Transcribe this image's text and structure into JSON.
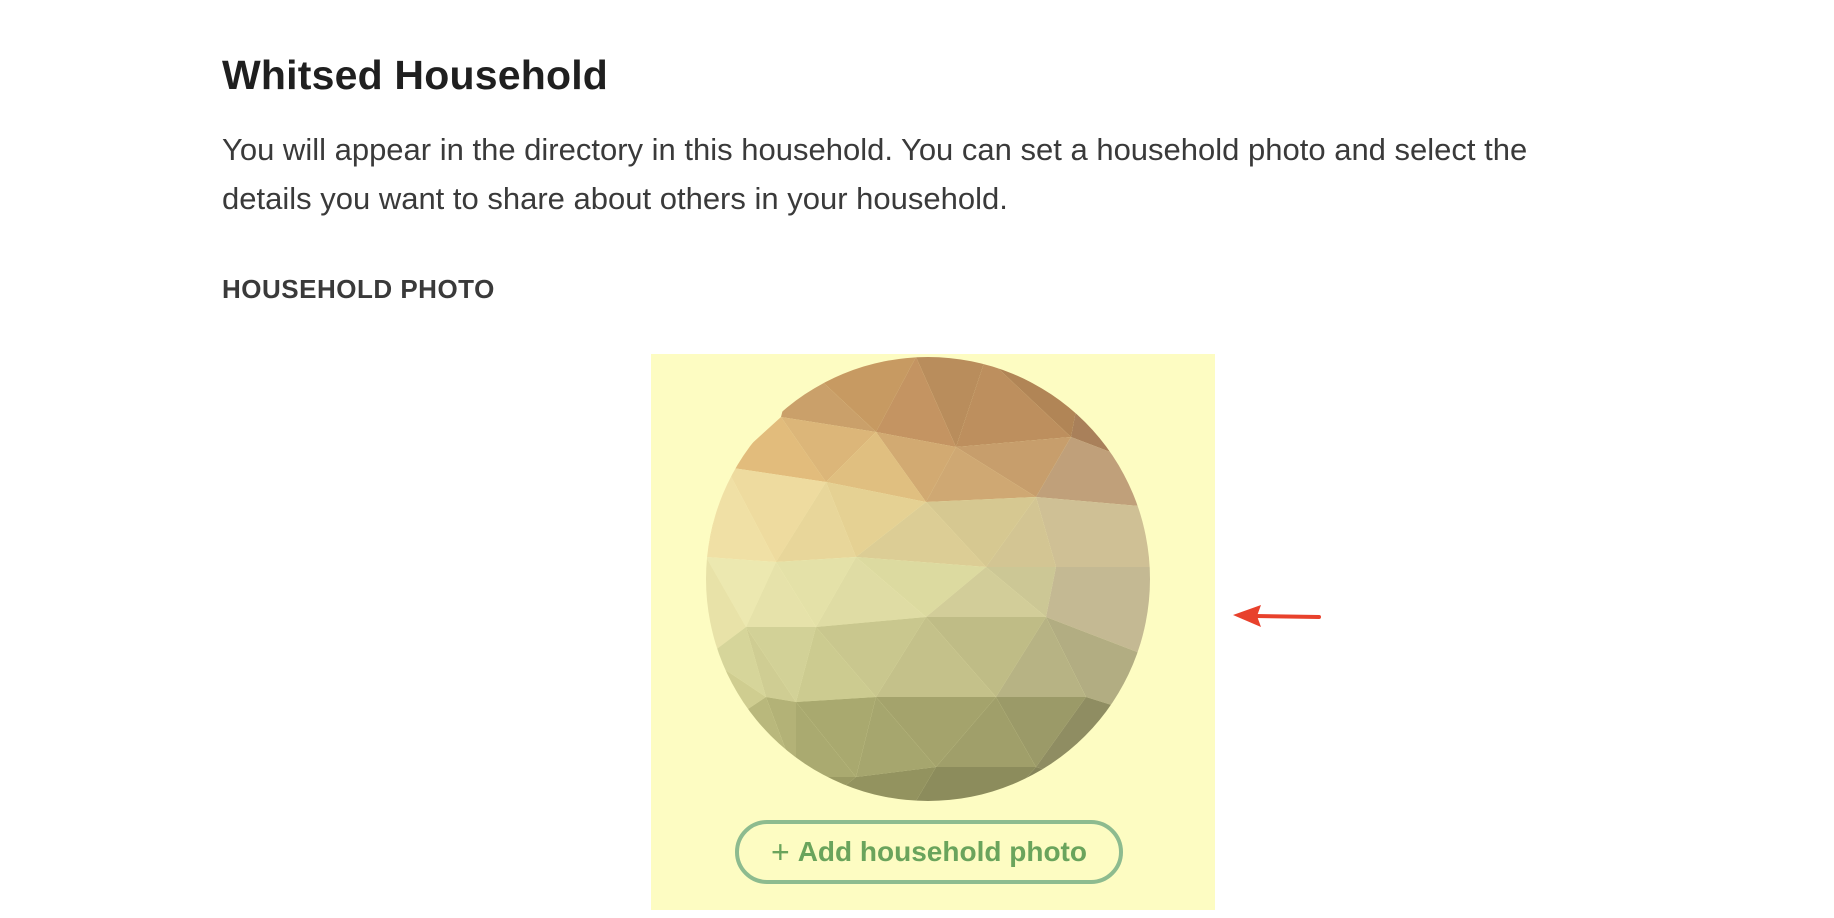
{
  "household": {
    "title": "Whitsed Household",
    "description": "You will appear in the directory in this household. You can set a household photo and select the details you want to share about others in your household."
  },
  "photo_section": {
    "label": "HOUSEHOLD PHOTO",
    "add_button": {
      "icon": "plus-icon",
      "icon_glyph": "+",
      "label": "Add household photo"
    },
    "placeholder_image": "low-poly-gradient",
    "panel_highlight_color": "#fdfcc2"
  },
  "annotation": {
    "icon": "arrow-left-icon",
    "color": "#e8412c"
  },
  "colors": {
    "button_text": "#6aa45c",
    "heading": "#1f1f1f",
    "body_text": "#3a3a3a"
  }
}
